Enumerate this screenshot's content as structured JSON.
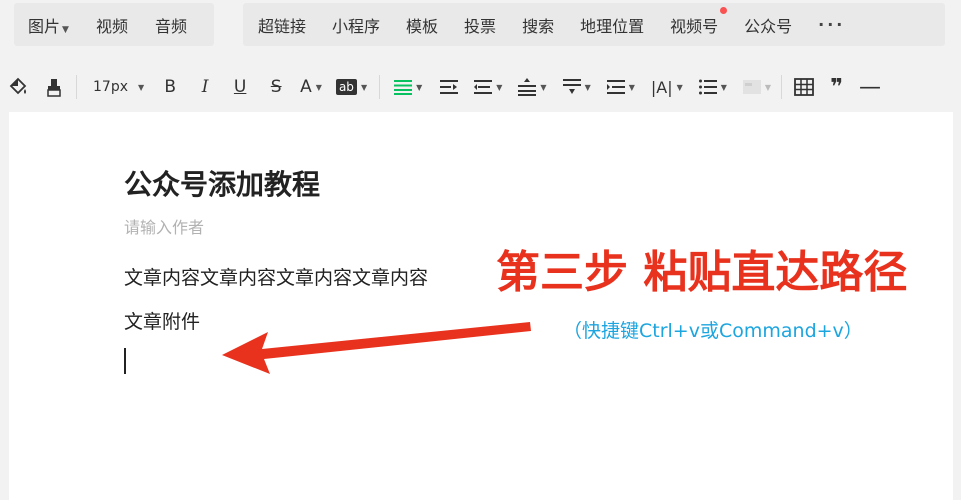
{
  "tabs_group1": [
    {
      "label": "图片",
      "dropdown": true
    },
    {
      "label": "视频"
    },
    {
      "label": "音频"
    }
  ],
  "tabs_group2": [
    {
      "label": "超链接"
    },
    {
      "label": "小程序"
    },
    {
      "label": "模板"
    },
    {
      "label": "投票"
    },
    {
      "label": "搜索"
    },
    {
      "label": "地理位置"
    },
    {
      "label": "视频号",
      "notification_dot": true
    },
    {
      "label": "公众号"
    }
  ],
  "more_label": "···",
  "toolbar": {
    "font_size": "17px",
    "bold": "B",
    "italic": "I",
    "underline": "U",
    "strike": "S",
    "font_color": "A",
    "highlight": "ab",
    "quote": "❞",
    "hr": "—",
    "tools": [
      "format-paint-icon",
      "format-brush-icon",
      "font-size-select",
      "bold-icon",
      "italic-icon",
      "underline-icon",
      "strikethrough-icon",
      "font-color-icon",
      "background-color-icon",
      "align-icon",
      "indent-icon",
      "outdent-icon",
      "line-height-icon",
      "paragraph-spacing-icon",
      "list-spacing-icon",
      "letter-spacing-icon",
      "bullet-list-icon",
      "table-style-icon",
      "table-icon",
      "quote-icon",
      "divider-icon"
    ]
  },
  "editor": {
    "title": "公众号添加教程",
    "author_placeholder": "请输入作者",
    "lines": [
      "文章内容文章内容文章内容文章内容",
      "文章附件"
    ]
  },
  "annotation": {
    "step": "第三步 粘贴直达路径",
    "shortcut": "（快捷键Ctrl+v或Command+v）",
    "step_color": "#e8321e",
    "shortcut_color": "#1da5df",
    "arrow_color": "#e8321e"
  },
  "colors": {
    "accent_green": "#07c160",
    "notification_red": "#fa5151"
  }
}
